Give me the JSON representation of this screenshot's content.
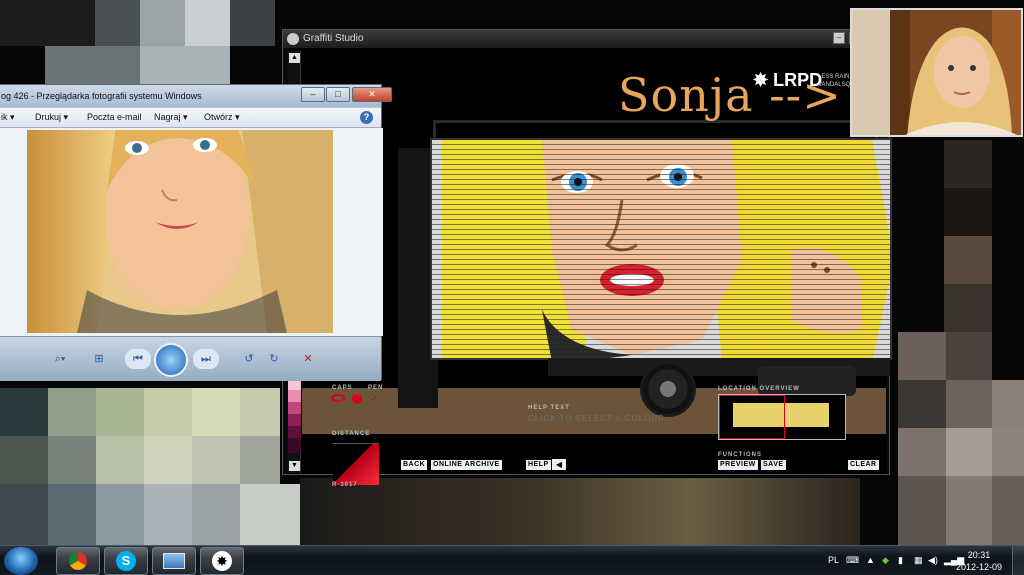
{
  "graffiti_studio": {
    "title": "Graffiti Studio",
    "overlay_text": "Sonja -->",
    "brand": "LRPD",
    "brand_sub": "LESS RAIN VANDALSQU",
    "labels": {
      "caps": "CAPS",
      "pen": "PEN",
      "distance": "DISTANCE",
      "help_text": "HELP TEXT",
      "location_overview": "LOCATION OVERVIEW",
      "functions": "FUNCTIONS",
      "color_code": "R-3017"
    },
    "help_message": "CLICK TO SELECT A COLOUR",
    "buttons": {
      "back": "BACK",
      "online_archive": "ONLINE ARCHIVE",
      "help": "HELP",
      "preview": "PREVIEW",
      "save": "SAVE",
      "clear": "CLEAR"
    }
  },
  "photo_viewer": {
    "title": "og 426 - Przeglądarka fotografii systemu Windows",
    "menu": [
      "ik",
      "Drukuj",
      "Poczta e-mail",
      "Nagraj",
      "Otwórz"
    ],
    "help_icon": "?"
  },
  "taskbar": {
    "apps": [
      "chrome-icon",
      "skype-icon",
      "photo-viewer-icon",
      "graffiti-studio-icon"
    ],
    "language": "PL",
    "time": "20:31",
    "date": "2012-12-09"
  },
  "colors": {
    "sonja_text": "#e8a55b",
    "accent_red": "#d9001a",
    "ground": "#6b543a"
  }
}
